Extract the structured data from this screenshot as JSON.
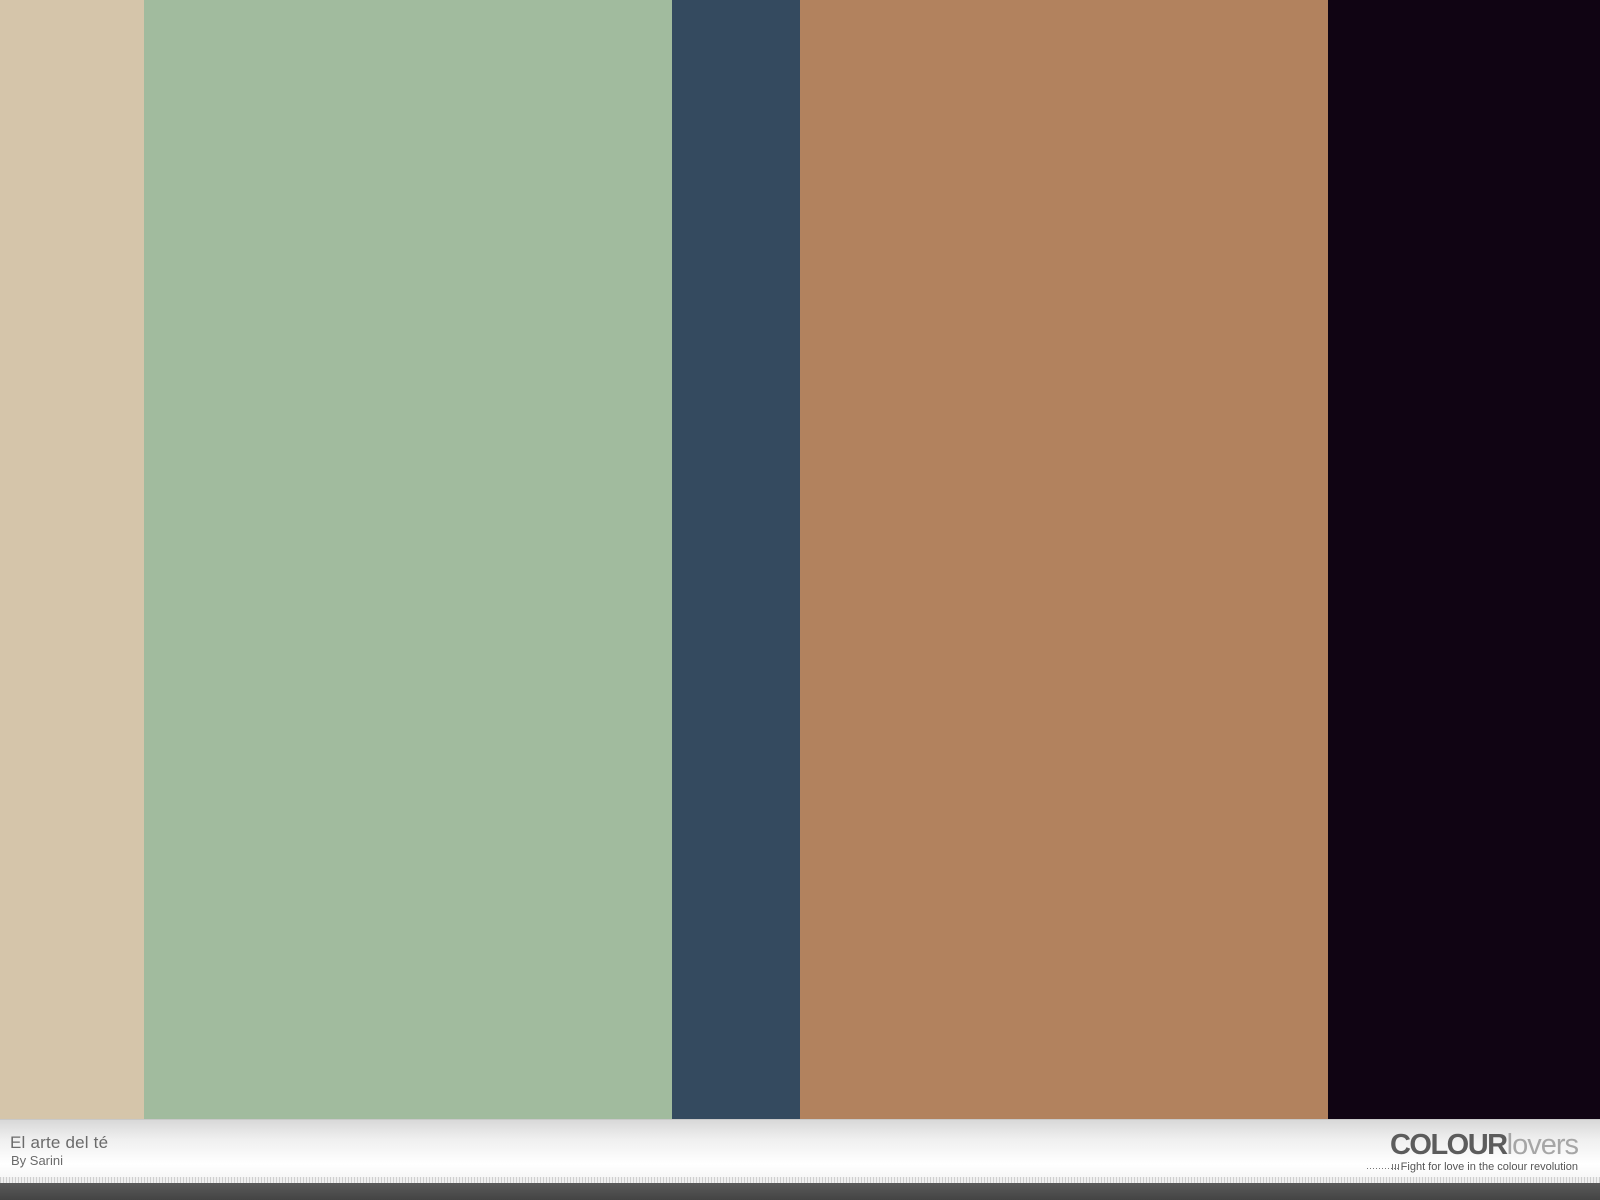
{
  "palette": {
    "title": "El arte del té",
    "author": "By Sarini",
    "swatches": [
      {
        "name": "swatch-1",
        "color": "#d5c5aa",
        "share": 0.09
      },
      {
        "name": "swatch-2",
        "color": "#a1bb9e",
        "share": 0.33
      },
      {
        "name": "swatch-3",
        "color": "#344a5f",
        "share": 0.08
      },
      {
        "name": "swatch-4",
        "color": "#b2825e",
        "share": 0.33
      },
      {
        "name": "swatch-5",
        "color": "#100413",
        "share": 0.17
      }
    ]
  },
  "brand": {
    "logo_strong": "COLOUR",
    "logo_light": "lovers",
    "tagline": "Fight for love in the colour revolution"
  }
}
